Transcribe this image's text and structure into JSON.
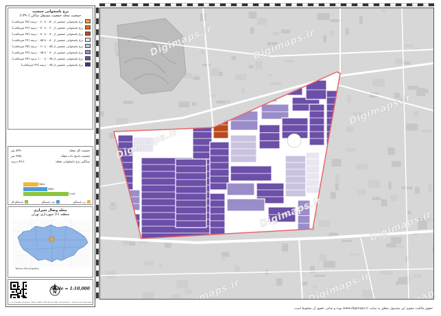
{
  "legend": {
    "title": "نرخ پاسخوانی جمعیت",
    "subtitle": "جمعیت محله جمعیت مستقل ساکن (۱۳۹۰)",
    "items": [
      {
        "label": "نرخ پاسخوانی جمعیتی از ۰.۵۰ تا ۰.۶۰ درصد (۴۸ مترمکعب)",
        "color": "#f6a13a"
      },
      {
        "label": "نرخ پاسخوانی جمعیتی از ۰.۶۰ تا ۰.۷۰ درصد (۴۹ مترمکعب)",
        "color": "#e06a28"
      },
      {
        "label": "نرخ پاسخوانی جمعیتی از ۰.۷۰ تا ۰.۸۰ درصد (۴۷ مترمکعب)",
        "color": "#b94a1e"
      },
      {
        "label": "نرخ پاسخوانی جمعیتی از ۰.۸۰ تا ۰.۸۵ درصد (۴۶ مترمکعب)",
        "color": "#e9e6f2"
      },
      {
        "label": "نرخ پاسخوانی جمعیتی از ۰.۸۵ تا ۰.۹۰ درصد (۴۵ مترمکعب)",
        "color": "#c9c3e0"
      },
      {
        "label": "نرخ پاسخوانی جمعیتی از ۰.۹۰ تا ۰.۹۵ درصد (۴۷ مترمکعب)",
        "color": "#9b8dc9"
      },
      {
        "label": "نرخ پاسخوانی جمعیتی از ۰.۹۵ تا ۱.۰۰ درصد (۴۸ مترمکعب)",
        "color": "#6c4fa8"
      },
      {
        "label": "نرخ پاسخوانی جمعیتی از ۰.۹۵ درصد (۴۹ مترمکعب)",
        "color": "#4b2f8a"
      }
    ]
  },
  "stats": {
    "rows": [
      {
        "label": "جمعیت کل محله:",
        "value": "۸۴۹۰ نفر"
      },
      {
        "label": "جمعیت پاسخ داده محله:",
        "value": "۳۹۵۱ نفر"
      },
      {
        "label": "میانگین نرخ پاسخوانی محله:",
        "value": "۸۹.۶ درصد"
      }
    ],
    "bars": [
      {
        "label": "زن پاسخگو",
        "value": "۳۵۹۸",
        "fraction": 0.33,
        "color": "#f2b542"
      },
      {
        "label": "مرد پاسخگو",
        "value": "۳۵۸۹",
        "fraction": 0.53,
        "color": "#4a9fd8"
      },
      {
        "label": "پاسخگو کل",
        "value": "۷۱۸۷",
        "fraction": 1.0,
        "color": "#8cc63f"
      }
    ]
  },
  "locator": {
    "title": "محله وصال شیرازی",
    "subtitle": "منطقه (۶) شهرداری تهران",
    "footer": "Tehran Municipality"
  },
  "scale": {
    "text": "Scale = 1:10,000",
    "credit": "Coordinate System: WGS 1984 UTM Zone 39N | Projection: Transverse Mercator"
  },
  "map": {
    "watermark": "Digimaps.ir",
    "footer_note": "حقوق مالکیت معنوی این محصول متعلق به سایت www.digimaps.ir بوده و تمامی حقوق آن محفوظ است.",
    "colors": {
      "background": "#d7d7d7",
      "boundary": "#e8666a",
      "street": "#ffffff"
    }
  }
}
